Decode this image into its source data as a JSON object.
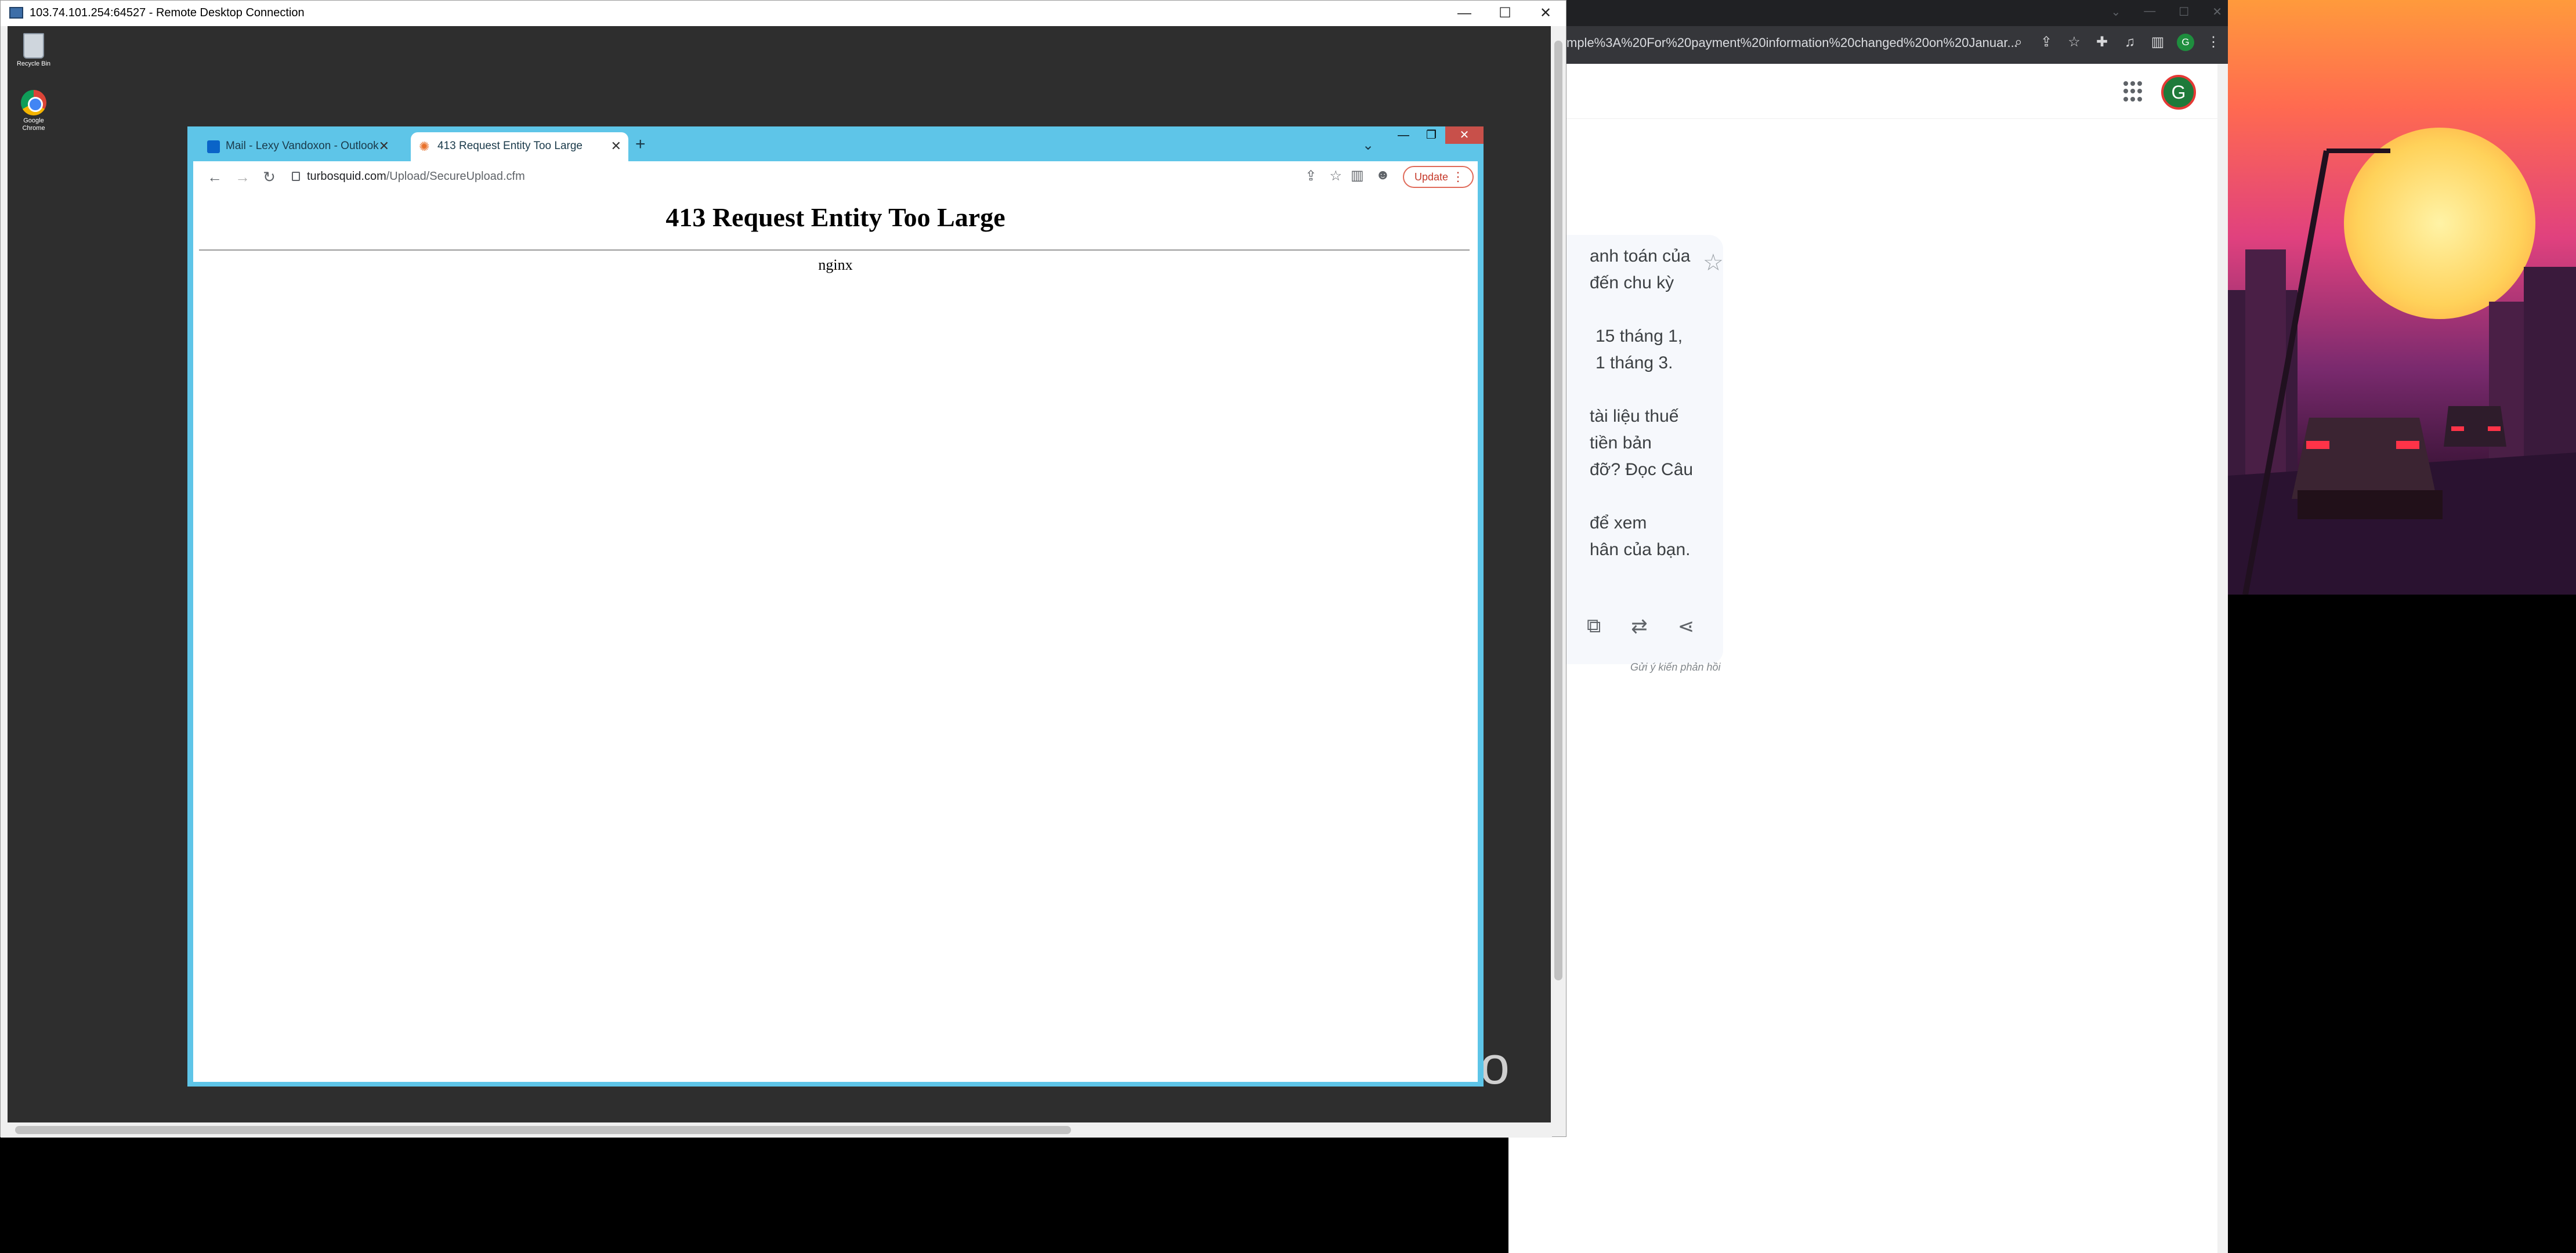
{
  "remote_desktop": {
    "title": "103.74.101.254:64527 - Remote Desktop Connection",
    "controls": [
      "—",
      "☐",
      "✕"
    ],
    "desktop_icons": [
      {
        "label": "Recycle Bin"
      },
      {
        "label": "Google Chrome"
      }
    ],
    "watermark": "indo"
  },
  "inner_browser": {
    "tabs": [
      {
        "label": "Mail - Lexy Vandoxon - Outlook",
        "close": "✕",
        "active": false
      },
      {
        "label": "413 Request Entity Too Large",
        "close": "✕",
        "active": true
      }
    ],
    "new_tab": "+",
    "tab_dropdown": "⌄",
    "window_controls": [
      "—",
      "❐",
      "✕"
    ],
    "nav": {
      "back": "←",
      "forward": "→",
      "reload": "↻"
    },
    "url_host": "turbosquid.com",
    "url_path": "/Upload/SecureUpload.cfm",
    "update_label": "Update",
    "update_menu": "⋮",
    "page": {
      "heading": "413 Request Entity Too Large",
      "server": "nginx"
    }
  },
  "background_browser": {
    "url_fragment": "mple%3A%20For%20payment%20information%20changed%20on%20Januar...",
    "profile_initial": "G",
    "avatar_initial": "G",
    "answer_lines": [
      "anh toán của",
      "đến chu kỳ",
      "",
      "15 tháng 1,",
      "1 tháng 3.",
      "",
      "tài liệu thuế",
      "tiền bản",
      "đỡ? Đọc Câu",
      "",
      "để xem",
      "hân của bạn."
    ],
    "feedback": "Gửi ý kiến phản hồi"
  },
  "colors": {
    "inner_frame": "#5ec5e8",
    "rdp_desktop": "#2e2e2e",
    "update_accent": "#c5392a"
  }
}
